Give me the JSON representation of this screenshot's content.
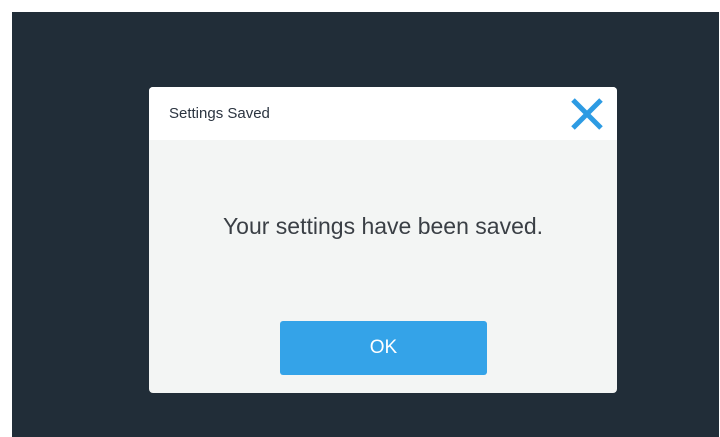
{
  "dialog": {
    "title": "Settings Saved",
    "message": "Your settings have been saved.",
    "ok_label": "OK",
    "close_icon": "close-icon"
  },
  "colors": {
    "backdrop": "#212d38",
    "dialog_body": "#f3f5f4",
    "header": "#ffffff",
    "accent": "#34a3e8",
    "close_icon": "#2d9be3"
  }
}
